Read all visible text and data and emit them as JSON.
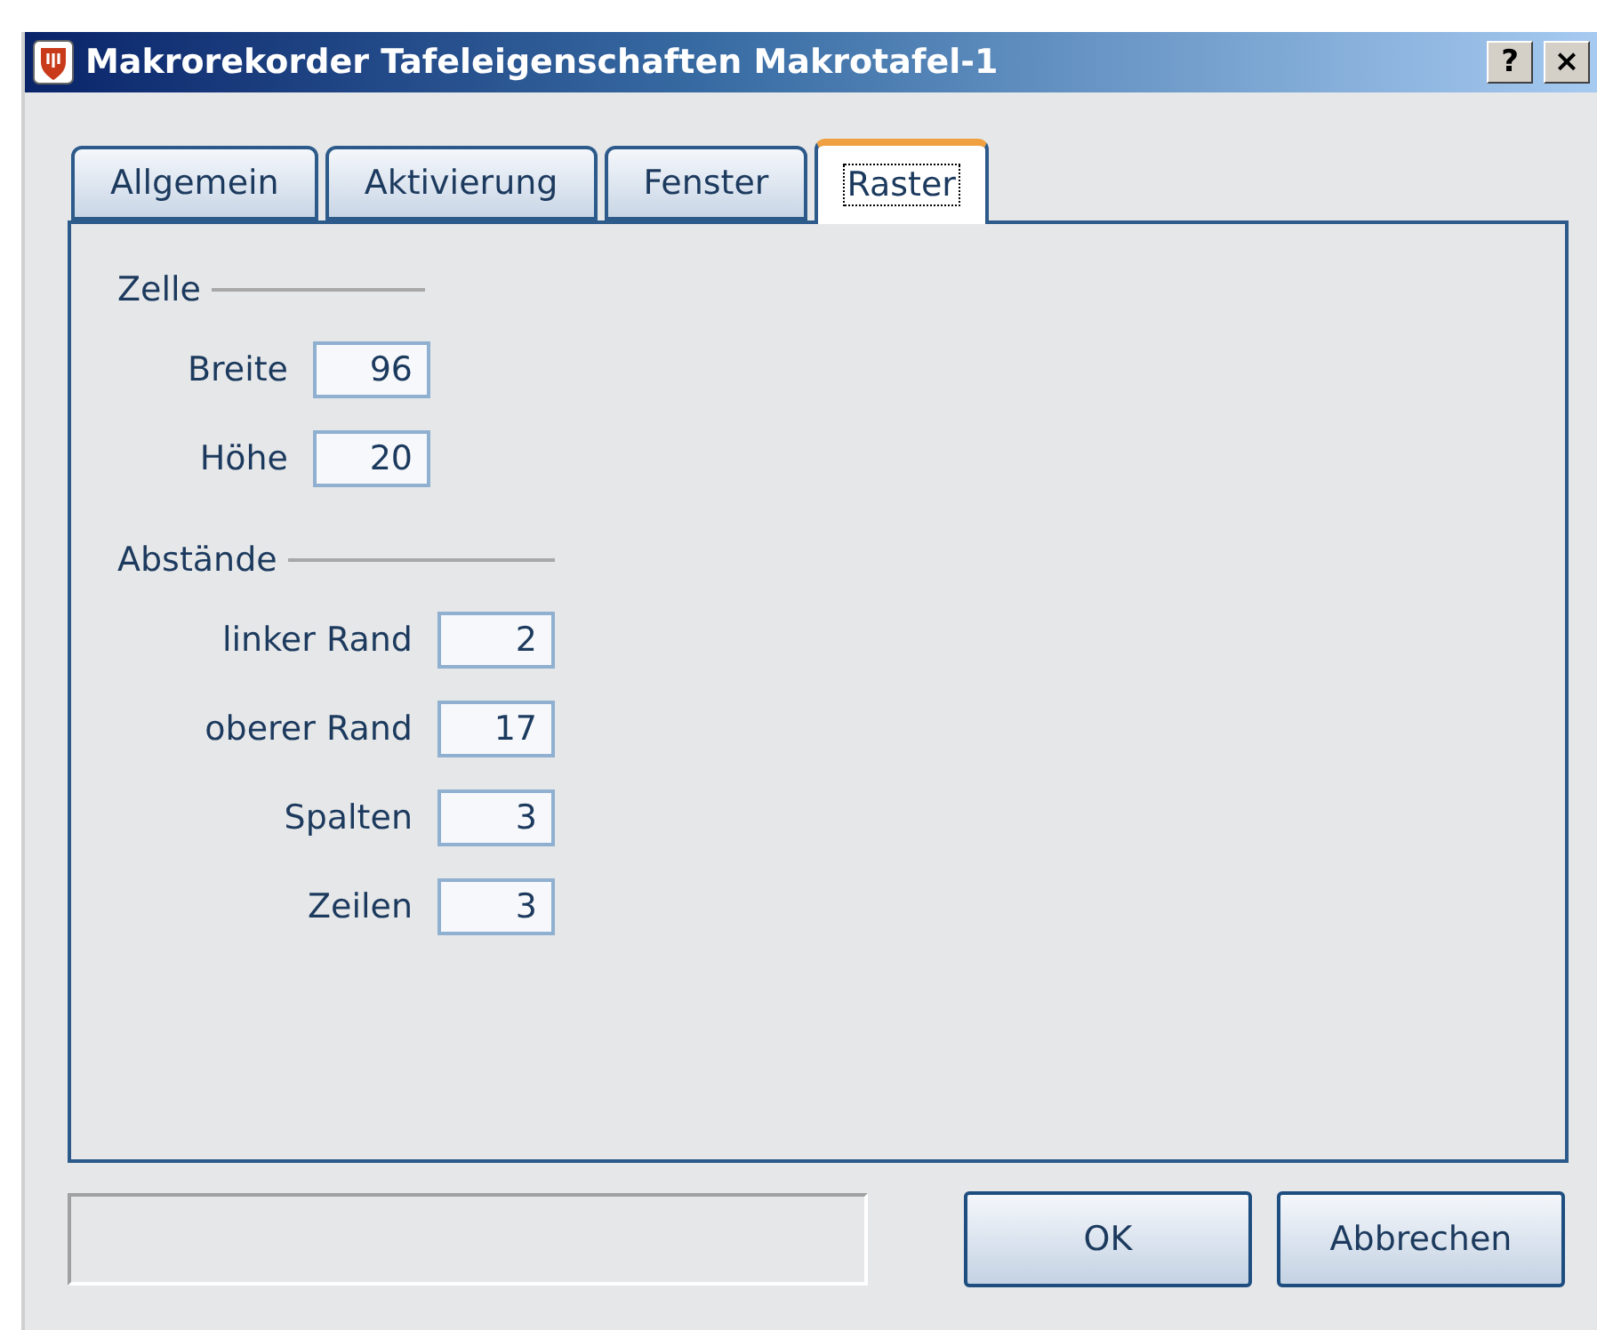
{
  "window": {
    "title": "Makrorekorder Tafeleigenschaften Makrotafel-1",
    "help_button": "?",
    "close_button": "×"
  },
  "tabs": [
    {
      "label": "Allgemein",
      "selected": false
    },
    {
      "label": "Aktivierung",
      "selected": false
    },
    {
      "label": "Fenster",
      "selected": false
    },
    {
      "label": "Raster",
      "selected": true
    }
  ],
  "groups": [
    {
      "title": "Zelle",
      "fields": [
        {
          "label": "Breite",
          "value": "96"
        },
        {
          "label": "Höhe",
          "value": "20"
        }
      ]
    },
    {
      "title": "Abstände",
      "fields": [
        {
          "label": "linker Rand",
          "value": "2"
        },
        {
          "label": "oberer Rand",
          "value": "17"
        },
        {
          "label": "Spalten",
          "value": "3"
        },
        {
          "label": "Zeilen",
          "value": "3"
        }
      ]
    }
  ],
  "buttons": [
    {
      "label": "OK"
    },
    {
      "label": "Abbrechen"
    }
  ]
}
